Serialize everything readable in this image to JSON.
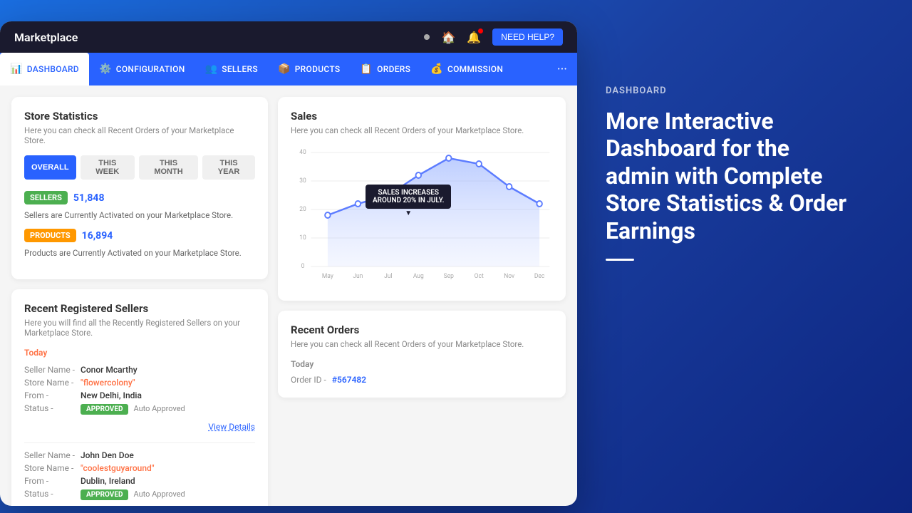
{
  "app": {
    "title": "Marketplace",
    "topbar": {
      "title": "Marketplace",
      "need_help": "NEED HELP?"
    }
  },
  "nav": {
    "items": [
      {
        "id": "dashboard",
        "label": "DASHBOARD",
        "icon": "📊",
        "active": true
      },
      {
        "id": "configuration",
        "label": "CONFIGURATION",
        "icon": "⚙️",
        "active": false
      },
      {
        "id": "sellers",
        "label": "SELLERS",
        "icon": "👥",
        "active": false
      },
      {
        "id": "products",
        "label": "PRODUCTS",
        "icon": "📦",
        "active": false
      },
      {
        "id": "orders",
        "label": "ORDERS",
        "icon": "📋",
        "active": false
      },
      {
        "id": "commission",
        "label": "COMMISSION",
        "icon": "💰",
        "active": false
      }
    ],
    "more_label": "···"
  },
  "store_statistics": {
    "title": "Store Statistics",
    "subtitle": "Here you can check all Recent Orders of your Marketplace Store.",
    "filters": [
      "OVERALL",
      "THIS WEEK",
      "THIS MONTH",
      "THIS YEAR"
    ],
    "active_filter": "OVERALL",
    "sellers": {
      "badge": "SELLERS",
      "count": "51,848",
      "desc": "Sellers are Currently Activated on your Marketplace Store."
    },
    "products": {
      "badge": "PRODUCTS",
      "count": "16,894",
      "desc": "Products are Currently Activated on your Marketplace Store."
    }
  },
  "recent_sellers": {
    "title": "Recent Registered Sellers",
    "subtitle": "Here you will find all the Recently Registered Sellers on your Marketplace Store.",
    "today_label": "Today",
    "sellers": [
      {
        "seller_name_label": "Seller Name -",
        "seller_name": "Conor Mcarthy",
        "store_name_label": "Store Name -",
        "store_name": "\"flowercolony\"",
        "from_label": "From -",
        "from": "New Delhi, India",
        "status_label": "Status -",
        "status": "APPROVED",
        "auto": "Auto Approved"
      },
      {
        "seller_name_label": "Seller Name -",
        "seller_name": "John Den Doe",
        "store_name_label": "Store Name -",
        "store_name": "\"coolestguyaround\"",
        "from_label": "From -",
        "from": "Dublin, Ireland",
        "status_label": "Status -",
        "status": "APPROVED",
        "auto": "Auto Approved"
      }
    ],
    "view_details": "View Details"
  },
  "sales": {
    "title": "Sales",
    "subtitle": "Here you can check all Recent Orders of your Marketplace Store.",
    "tooltip": {
      "line1": "SALES INCREASES",
      "line2": "AROUND 20% IN JULY."
    },
    "chart": {
      "x_labels": [
        "May",
        "Jun",
        "Jul",
        "Aug",
        "Sep",
        "Oct",
        "Nov",
        "Dec"
      ],
      "y_labels": [
        "0",
        "10",
        "20",
        "30",
        "40"
      ],
      "data_points": [
        {
          "month": "May",
          "value": 18
        },
        {
          "month": "Jun",
          "value": 22
        },
        {
          "month": "Jul",
          "value": 25
        },
        {
          "month": "Aug",
          "value": 32
        },
        {
          "month": "Sep",
          "value": 38
        },
        {
          "month": "Oct",
          "value": 36
        },
        {
          "month": "Nov",
          "value": 28
        },
        {
          "month": "Dec",
          "value": 22
        }
      ]
    }
  },
  "recent_orders": {
    "title": "Recent Orders",
    "subtitle": "Here you can check all Recent Orders of your Marketplace Store.",
    "today_label": "Today",
    "order_id_label": "Order ID -",
    "order_id": "#567482"
  },
  "right_panel": {
    "label": "DASHBOARD",
    "heading_line1": "More Interactive",
    "heading_line2": "Dashboard for the",
    "heading_line3": "admin with Complete",
    "heading_line4": "Store Statistics & Order",
    "heading_line5": "Earnings"
  }
}
